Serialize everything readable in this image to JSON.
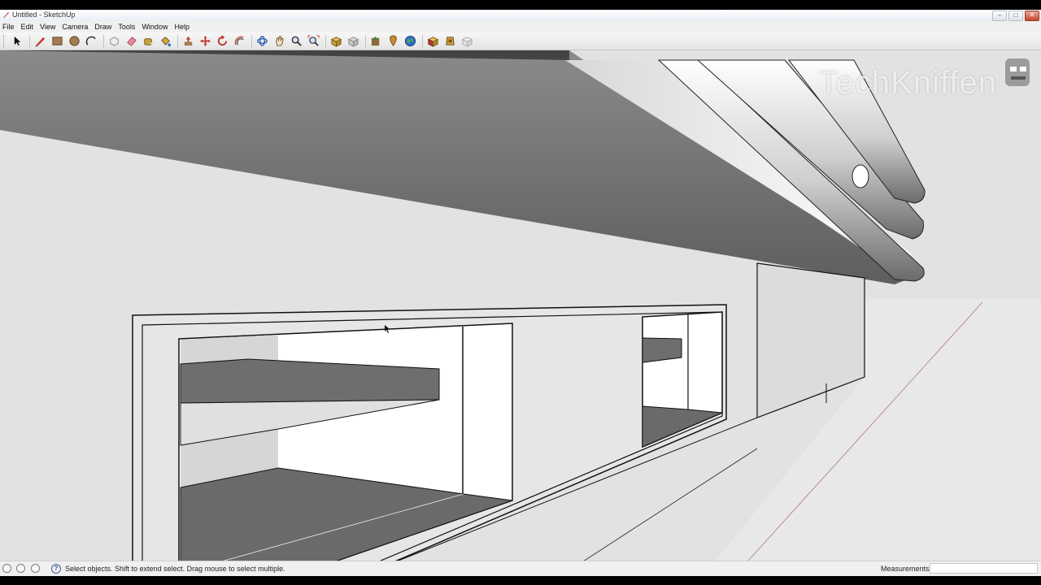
{
  "window": {
    "title": "Untitled - SketchUp",
    "controls": [
      "–",
      "□",
      "✕"
    ]
  },
  "menu": [
    "File",
    "Edit",
    "View",
    "Camera",
    "Draw",
    "Tools",
    "Window",
    "Help"
  ],
  "toolbar": [
    {
      "name": "select-tool-icon"
    },
    {
      "name": "pencil-line-tool-icon"
    },
    {
      "name": "rectangle-tool-icon"
    },
    {
      "name": "circle-tool-icon"
    },
    {
      "name": "arc-tool-icon"
    },
    {
      "name": "make-component-icon"
    },
    {
      "name": "eraser-tool-icon"
    },
    {
      "name": "tape-measure-tool-icon"
    },
    {
      "name": "paint-bucket-tool-icon"
    },
    {
      "name": "push-pull-tool-icon"
    },
    {
      "name": "move-tool-icon"
    },
    {
      "name": "rotate-tool-icon"
    },
    {
      "name": "offset-tool-icon"
    },
    {
      "name": "orbit-tool-icon"
    },
    {
      "name": "pan-tool-icon"
    },
    {
      "name": "zoom-tool-icon"
    },
    {
      "name": "zoom-extents-icon"
    },
    {
      "name": "get-models-icon"
    },
    {
      "name": "share-model-icon"
    },
    {
      "name": "get-photo-texture-icon"
    },
    {
      "name": "add-location-icon"
    },
    {
      "name": "google-earth-icon"
    },
    {
      "name": "extension-warehouse-icon"
    },
    {
      "name": "get-components-icon"
    },
    {
      "name": "share-component-icon"
    }
  ],
  "watermark": {
    "text": "TechKniffen"
  },
  "status": {
    "message": "Select objects. Shift to extend select. Drag mouse to select multiple.",
    "measurements_label": "Measurements",
    "measurements_value": ""
  },
  "colors": {
    "dark_face": "#6e6e6e",
    "light_face": "#e4e4e4",
    "mid_face": "#bdbdbd"
  }
}
